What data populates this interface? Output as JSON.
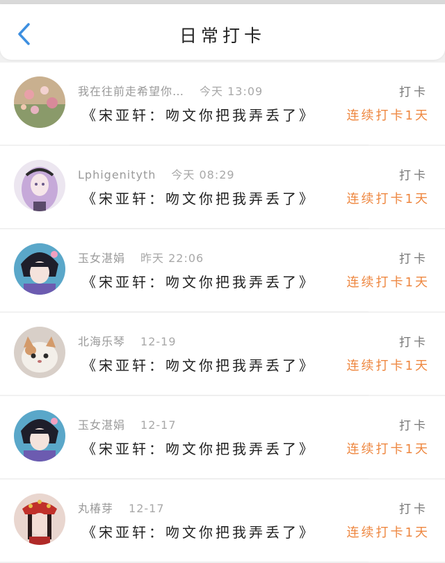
{
  "header": {
    "title": "日常打卡",
    "back_icon": "chevron-left-icon",
    "accent": "#3d8fe0"
  },
  "colors": {
    "streak": "#ee8740"
  },
  "entries": [
    {
      "user": "我在往前走希望你…",
      "time": "今天 13:09",
      "content": "《宋亚轩：吻文你把我弄丢了》",
      "type": "打卡",
      "streak": "连续打卡1天",
      "avatar": "avatar-flowers"
    },
    {
      "user": "Lphigenityth",
      "time": "今天 08:29",
      "content": "《宋亚轩：吻文你把我弄丢了》",
      "type": "打卡",
      "streak": "连续打卡1天",
      "avatar": "avatar-anime-girl"
    },
    {
      "user": "玉女湛娟",
      "time": "昨天 22:06",
      "content": "《宋亚轩：吻文你把我弄丢了》",
      "type": "打卡",
      "streak": "连续打卡1天",
      "avatar": "avatar-anime-boy"
    },
    {
      "user": "北海乐琴",
      "time": "12-19",
      "content": "《宋亚轩：吻文你把我弄丢了》",
      "type": "打卡",
      "streak": "连续打卡1天",
      "avatar": "avatar-cat"
    },
    {
      "user": "玉女湛娟",
      "time": "12-17",
      "content": "《宋亚轩：吻文你把我弄丢了》",
      "type": "打卡",
      "streak": "连续打卡1天",
      "avatar": "avatar-anime-boy"
    },
    {
      "user": "丸椿芽",
      "time": "12-17",
      "content": "《宋亚轩：吻文你把我弄丢了》",
      "type": "打卡",
      "streak": "连续打卡1天",
      "avatar": "avatar-costume-girl"
    }
  ]
}
